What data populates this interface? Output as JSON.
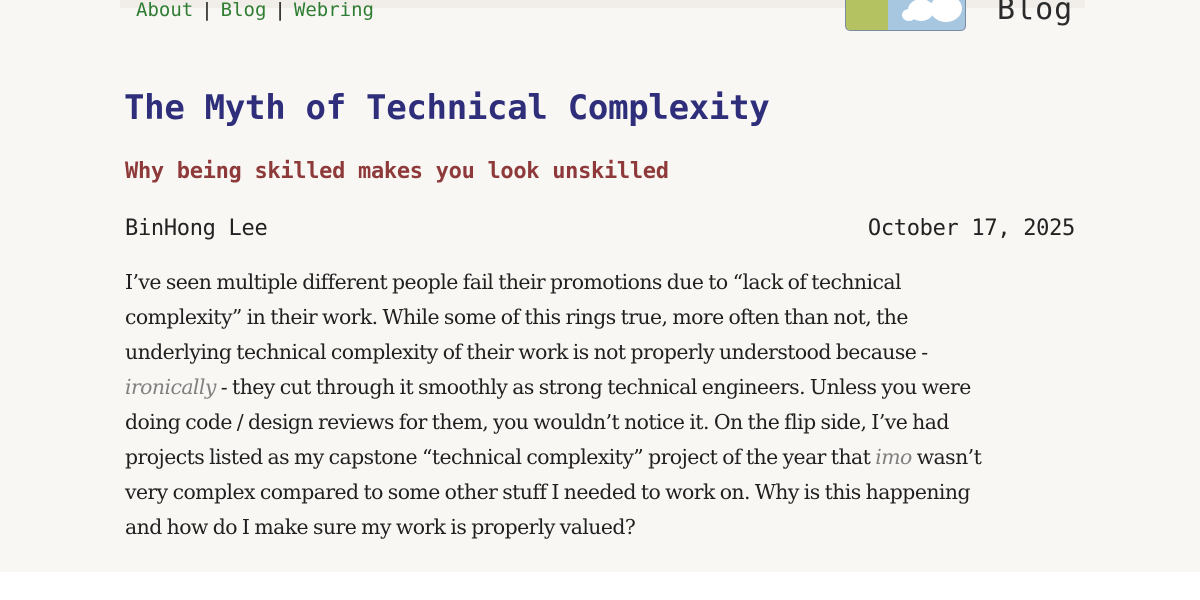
{
  "nav": {
    "items": [
      "About",
      "Blog",
      "Webring"
    ],
    "separator": "|"
  },
  "header": {
    "blog_title": "Blog"
  },
  "article": {
    "title": "The Myth of Technical Complexity",
    "subtitle": "Why being skilled makes you look unskilled",
    "author": "BinHong Lee",
    "date": "October 17, 2025",
    "lines": [
      {
        "text": "I’ve seen multiple different people fail their promotions due to “lack of technical"
      },
      {
        "text": "complexity” in their work. While some of this rings true, more often than not, the"
      },
      {
        "text": "underlying technical complexity of their work is not properly understood because -"
      },
      {
        "em": "ironically",
        "after": " - they cut through it smoothly as strong technical engineers. Unless you were"
      },
      {
        "text": "doing code / design reviews for them, you wouldn’t notice it. On the flip side, I’ve had"
      },
      {
        "before": "projects listed as my capstone “technical complexity” project of the year that ",
        "em": "imo",
        "after": " wasn’t"
      },
      {
        "text": "very complex compared to some other stuff I needed to work on. Why is this happening"
      },
      {
        "text": "and how do I make sure my work is properly valued?"
      }
    ]
  },
  "colors": {
    "title": "#2e2e7a",
    "subtitle": "#8e3a3a",
    "nav_link": "#2e7d32",
    "emphasis": "#808080",
    "background": "#f9f7f4"
  },
  "icons": {
    "logo": "blog-logo-image"
  }
}
